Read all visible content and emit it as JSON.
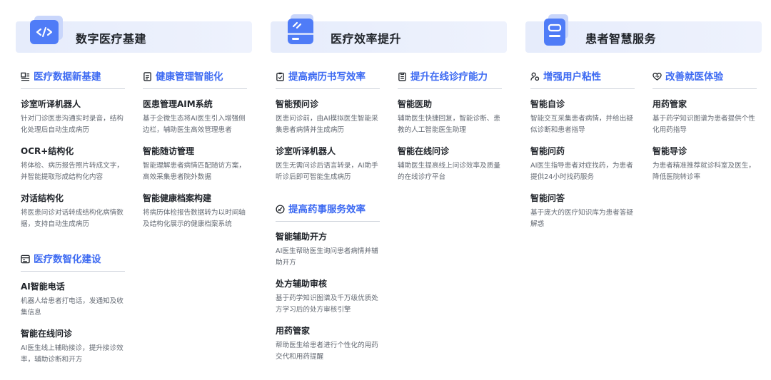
{
  "columns": [
    {
      "title": "数字医疗基建",
      "icon": "code-icon",
      "subsections": [
        {
          "title": "医疗数据新基建",
          "icon": "data-list-icon",
          "items": [
            {
              "title": "诊室听译机器人",
              "desc": "针对门诊医患沟通实时录音，结构化处理后自动生成病历"
            },
            {
              "title": "OCR+结构化",
              "desc": "将体检、病历报告照片转成文字，并智能提取形成结构化内容"
            },
            {
              "title": "对话结构化",
              "desc": "将医患问诊对话转成结构化病情数据，支持自动生成病历"
            }
          ]
        },
        {
          "title": "健康管理智能化",
          "icon": "document-icon",
          "items": [
            {
              "title": "医患管理AIM系统",
              "desc": "基于企微生态将AI医生引入增强侧边栏，辅助医生高效管理患者"
            },
            {
              "title": "智能随访管理",
              "desc": "智能理解患者病情匹配随访方案，高效采集患者院外数据"
            },
            {
              "title": "智能健康档案构建",
              "desc": "将病历体检报告数据转为以时间轴及结构化展示的健康档案系统"
            }
          ]
        },
        {
          "title": "医疗数智化建设",
          "icon": "dashboard-icon",
          "items": [
            {
              "title": "AI智能电话",
              "desc": "机器人给患者打电话，发通知及收集信息"
            },
            {
              "title": "智能在线问诊",
              "desc": "AI医生线上辅助接诊，提升接诊效率，辅助诊断和开方"
            }
          ]
        }
      ]
    },
    {
      "title": "医疗效率提升",
      "icon": "card-icon",
      "subsections": [
        {
          "title": "提高病历书写效率",
          "icon": "clipboard-icon",
          "items": [
            {
              "title": "智能预问诊",
              "desc": "医患问诊前，由AI模拟医生智能采集患者病情并生成病历"
            },
            {
              "title": "诊室听译机器人",
              "desc": "医生无需问诊后语言转录，AI助手听诊后即可智能生成病历"
            }
          ]
        },
        {
          "title": "提升在线诊疗能力",
          "icon": "list-doc-icon",
          "items": [
            {
              "title": "智能医助",
              "desc": "辅助医生快捷回复，智能诊断、患教的人工智能医生助理"
            },
            {
              "title": "智能在线问诊",
              "desc": "辅助医生提高线上问诊效率及质量的在线诊疗平台"
            }
          ]
        },
        {
          "title": "提高药事服务效率",
          "icon": "pill-icon",
          "items": [
            {
              "title": "智能辅助开方",
              "desc": "AI医生帮助医生询问患者病情并辅助开方"
            },
            {
              "title": "处方辅助审核",
              "desc": "基于药学知识图谱及千万级优质处方学习后的处方审核引擎"
            },
            {
              "title": "用药管家",
              "desc": "帮助医生给患者进行个性化的用药交代和用药提醒"
            }
          ]
        }
      ]
    },
    {
      "title": "患者智慧服务",
      "icon": "document-lines-icon",
      "subsections": [
        {
          "title": "增强用户粘性",
          "icon": "user-link-icon",
          "items": [
            {
              "title": "智能自诊",
              "desc": "智能交互采集患者病情，并给出疑似诊断和患者指导"
            },
            {
              "title": "智能问药",
              "desc": "AI医生指导患者对症找药，为患者提供24小时找药服务"
            },
            {
              "title": "智能问答",
              "desc": "基于庞大的医疗知识库为患者答疑解惑"
            }
          ]
        },
        {
          "title": "改善就医体验",
          "icon": "heart-icon",
          "items": [
            {
              "title": "用药管家",
              "desc": "基于药学知识图谱为患者提供个性化用药指导"
            },
            {
              "title": "智能导诊",
              "desc": "为患者精准推荐就诊科室及医生，降低医院转诊率"
            }
          ]
        }
      ]
    }
  ],
  "colors": {
    "accent": "#3d6af2",
    "banner_bg": "#e9eefc",
    "title": "#1f2329",
    "desc": "#646a73"
  }
}
